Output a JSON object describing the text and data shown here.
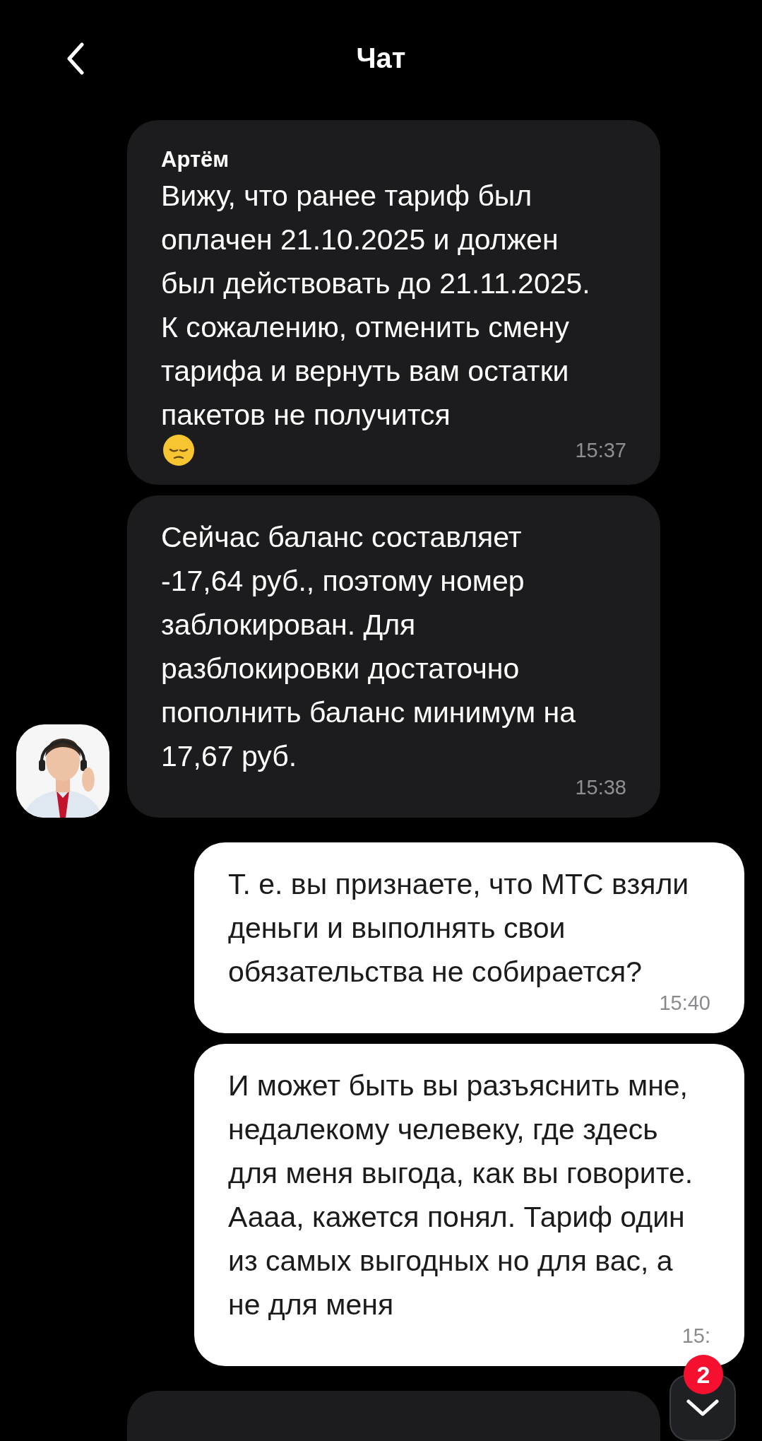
{
  "header": {
    "title": "Чат"
  },
  "messages": [
    {
      "kind": "incoming",
      "author": "Артём",
      "text": "Вижу, что ранее тариф был оплачен 21.10.2025 и должен был действовать до 21.11.2025. К сожалению, отменить смену тарифа и вернуть вам остатки пакетов не получится",
      "emoji": true,
      "time": "15:37",
      "avatar": false
    },
    {
      "kind": "incoming",
      "text": "Сейчас баланс составляет -17,64 руб., поэтому номер заблокирован. Для разблокировки достаточно пополнить баланс минимум на 17,67 руб.",
      "time": "15:38",
      "avatar": true
    },
    {
      "kind": "outgoing",
      "text": "Т. е. вы признаете, что МТС взяли деньги и выполнять свои обязательства не собирается?",
      "time": "15:40"
    },
    {
      "kind": "outgoing",
      "text": "И может быть вы разъяснить мне, недалекому челевеку, где здесь для меня выгода, как вы говорите. Аааа, кажется понял. Тариф один из самых выгодных но для вас, а не для меня",
      "time": "15:"
    }
  ],
  "scroll_button": {
    "badge": "2"
  }
}
